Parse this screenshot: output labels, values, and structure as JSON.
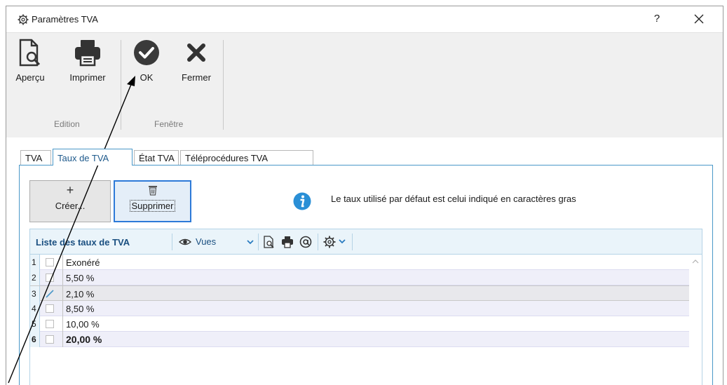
{
  "window": {
    "title": "Paramètres TVA",
    "help_label": "?"
  },
  "ribbon": {
    "buttons": [
      {
        "label": "Aperçu",
        "icon": "preview-icon"
      },
      {
        "label": "Imprimer",
        "icon": "printer-icon"
      },
      {
        "label": "OK",
        "icon": "check-circle-icon"
      },
      {
        "label": "Fermer",
        "icon": "close-x-icon"
      }
    ],
    "groups": {
      "edition": "Edition",
      "fenetre": "Fenêtre"
    }
  },
  "tabs": [
    {
      "label": "TVA",
      "active": false
    },
    {
      "label": "Taux de TVA",
      "active": true
    },
    {
      "label": "État TVA",
      "active": false
    },
    {
      "label": "Téléprocédures TVA",
      "active": false
    }
  ],
  "actions": {
    "create_plus": "+",
    "create_label": "Créer...",
    "delete_label": "Supprimer"
  },
  "info": {
    "icon": "info-icon",
    "text": "Le taux utilisé par défaut est celui indiqué en caractères gras"
  },
  "grid": {
    "title": "Liste des taux de TVA",
    "vues_label": "Vues",
    "rows": [
      {
        "num": "1",
        "value": "Exonéré",
        "checked": false,
        "bold": false
      },
      {
        "num": "2",
        "value": "5,50 %",
        "checked": false,
        "bold": false
      },
      {
        "num": "3",
        "value": "2,10 %",
        "checked": true,
        "bold": false
      },
      {
        "num": "4",
        "value": "8,50 %",
        "checked": false,
        "bold": false
      },
      {
        "num": "5",
        "value": "10,00 %",
        "checked": false,
        "bold": false
      },
      {
        "num": "6",
        "value": "20,00 %",
        "checked": false,
        "bold": true
      }
    ]
  },
  "colors": {
    "accent_blue": "#4a98c8",
    "grid_header_bg": "#eaf4fa",
    "ribbon_bg": "#f0f0f0",
    "selected_button_border": "#2d7ad8"
  }
}
